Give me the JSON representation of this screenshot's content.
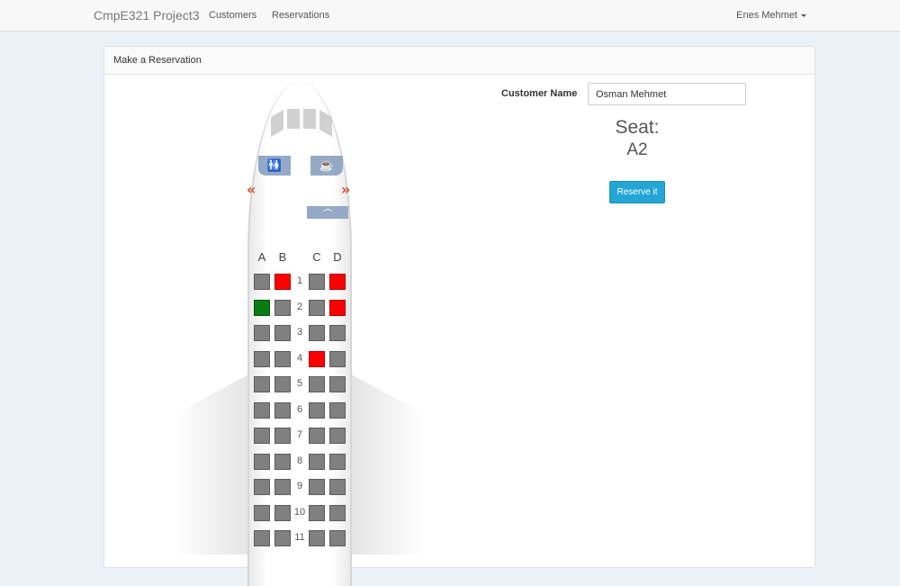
{
  "navbar": {
    "brand": "CmpE321 Project3",
    "links": [
      {
        "label": "Customers"
      },
      {
        "label": "Reservations"
      }
    ],
    "user": "Enes Mehmet"
  },
  "panel": {
    "heading": "Make a Reservation"
  },
  "plane": {
    "columns": [
      "A",
      "B",
      "C",
      "D"
    ],
    "facilities": {
      "toilet": "🚻",
      "galley": "☕",
      "coat": "⌒"
    },
    "exit_left": "«",
    "exit_right": "»",
    "rows": [
      {
        "number": "1",
        "seats": [
          "available",
          "taken",
          "available",
          "taken"
        ]
      },
      {
        "number": "2",
        "seats": [
          "selected",
          "available",
          "available",
          "taken"
        ]
      },
      {
        "number": "3",
        "seats": [
          "available",
          "available",
          "available",
          "available"
        ]
      },
      {
        "number": "4",
        "seats": [
          "available",
          "available",
          "taken",
          "available"
        ]
      },
      {
        "number": "5",
        "seats": [
          "available",
          "available",
          "available",
          "available"
        ]
      },
      {
        "number": "6",
        "seats": [
          "available",
          "available",
          "available",
          "available"
        ]
      },
      {
        "number": "7",
        "seats": [
          "available",
          "available",
          "available",
          "available"
        ]
      },
      {
        "number": "8",
        "seats": [
          "available",
          "available",
          "available",
          "available"
        ]
      },
      {
        "number": "9",
        "seats": [
          "available",
          "available",
          "available",
          "available"
        ]
      },
      {
        "number": "10",
        "seats": [
          "available",
          "available",
          "available",
          "available"
        ]
      },
      {
        "number": "11",
        "seats": [
          "available",
          "available",
          "available",
          "available"
        ]
      }
    ],
    "colors": {
      "available": "#808080",
      "taken": "#ff0000",
      "selected": "#0a7a12"
    }
  },
  "form": {
    "customer_label": "Customer Name",
    "customer_value": "Osman Mehmet",
    "seat_heading": "Seat:",
    "seat_value": "A2",
    "reserve_label": "Reserve it",
    "accent": "#23a6d5"
  }
}
